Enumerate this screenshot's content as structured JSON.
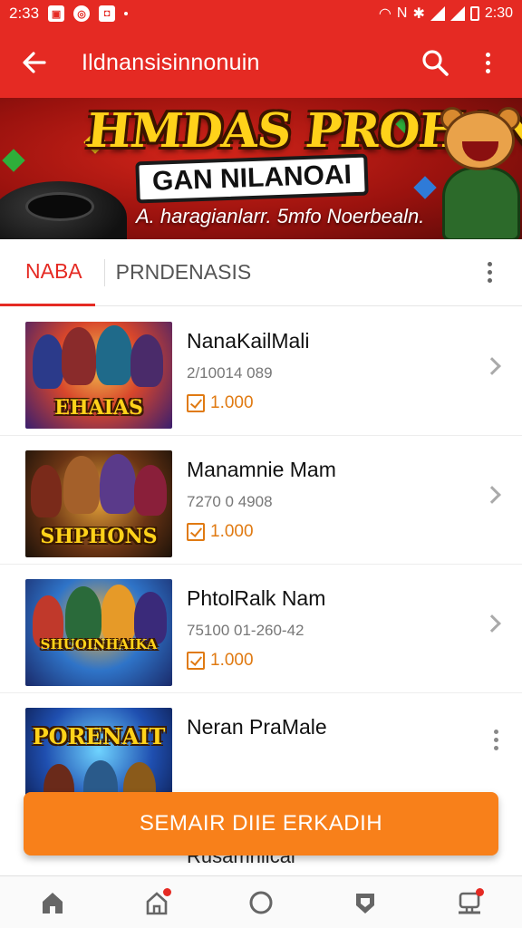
{
  "status_bar": {
    "time_left": "2:33",
    "time_right": "2:30"
  },
  "app_bar": {
    "title": "Ildnansisinnonuin",
    "back_icon": "arrow-left-icon",
    "search_icon": "search-icon",
    "more_icon": "more-vert-icon"
  },
  "banner": {
    "headline": "HMDAS PROHAN",
    "subheadline": "GAN NILANOAI",
    "caption": "A. haragianlarr. 5mfo Noerbealn.",
    "accent_color": "#d4251a"
  },
  "tabs": [
    {
      "label": "NABA",
      "active": true
    },
    {
      "label": "PRNDENASIS",
      "active": false
    }
  ],
  "games": [
    {
      "name": "NanaKailMali",
      "meta": "2/10014 089",
      "price": "1.000",
      "thumb_logo": "EHAIAS"
    },
    {
      "name": "Manamnie Mam",
      "meta": "7270 0 4908",
      "price": "1.000",
      "thumb_logo": "SHPHONS"
    },
    {
      "name": "PhtolRalk Nam",
      "meta": "75100 01-260-42",
      "price": "1.000",
      "thumb_logo": "SHUOINHAIKA"
    },
    {
      "name": "Neran PraMale",
      "meta": "",
      "price": "",
      "thumb_logo": "PORENAIT"
    }
  ],
  "peek_text": "Rusamniical",
  "cta": {
    "label": "SEMAIR DIIE ERKADIH",
    "color": "#f8801a"
  },
  "bottom_nav": [
    {
      "icon": "home-icon",
      "badge": false
    },
    {
      "icon": "house-alert-icon",
      "badge": true
    },
    {
      "icon": "circle-icon",
      "badge": false
    },
    {
      "icon": "shield-icon",
      "badge": false
    },
    {
      "icon": "profile-icon",
      "badge": true
    }
  ],
  "colors": {
    "primary": "#e52a23",
    "accent": "#f8801a",
    "price": "#e07a12"
  }
}
